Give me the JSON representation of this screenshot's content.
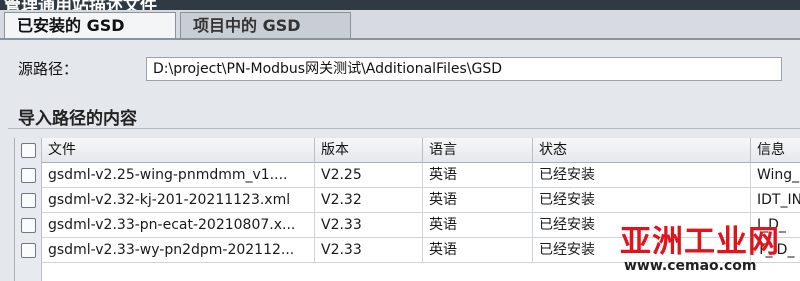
{
  "window": {
    "title": "管理通用站描述文件"
  },
  "tabs": [
    {
      "label": "已安装的 GSD",
      "active": true
    },
    {
      "label": "项目中的 GSD",
      "active": false
    }
  ],
  "source": {
    "label": "源路径：",
    "value": "D:\\project\\PN-Modbus网关测试\\AdditionalFiles\\GSD"
  },
  "section": {
    "title": "导入路径的内容"
  },
  "table": {
    "columns": {
      "file": "文件",
      "version": "版本",
      "language": "语言",
      "status": "状态",
      "info": "信息"
    },
    "rows": [
      {
        "file": "gsdml-v2.25-wing-pnmdmm_v1....",
        "version": "V2.25",
        "language": "英语",
        "status": "已经安装",
        "info": "Wing_"
      },
      {
        "file": "gsdml-v2.32-kj-201-20211123.xml",
        "version": "V2.32",
        "language": "英语",
        "status": "已经安装",
        "info": "IDT_IN"
      },
      {
        "file": "gsdml-v2.33-pn-ecat-20210807.x...",
        "version": "V2.33",
        "language": "英语",
        "status": "已经安装",
        "info": "I_D_"
      },
      {
        "file": "gsdml-v2.33-wy-pn2dpm-202112...",
        "version": "V2.33",
        "language": "英语",
        "status": "已经安装",
        "info": "T_ID_"
      }
    ]
  },
  "watermark": {
    "text": "亚洲工业网",
    "url": "www.cemao.com"
  },
  "colors": {
    "watermark": "#e0141c",
    "titlebar": "#2f3a44",
    "background": "#e4e7ec"
  }
}
